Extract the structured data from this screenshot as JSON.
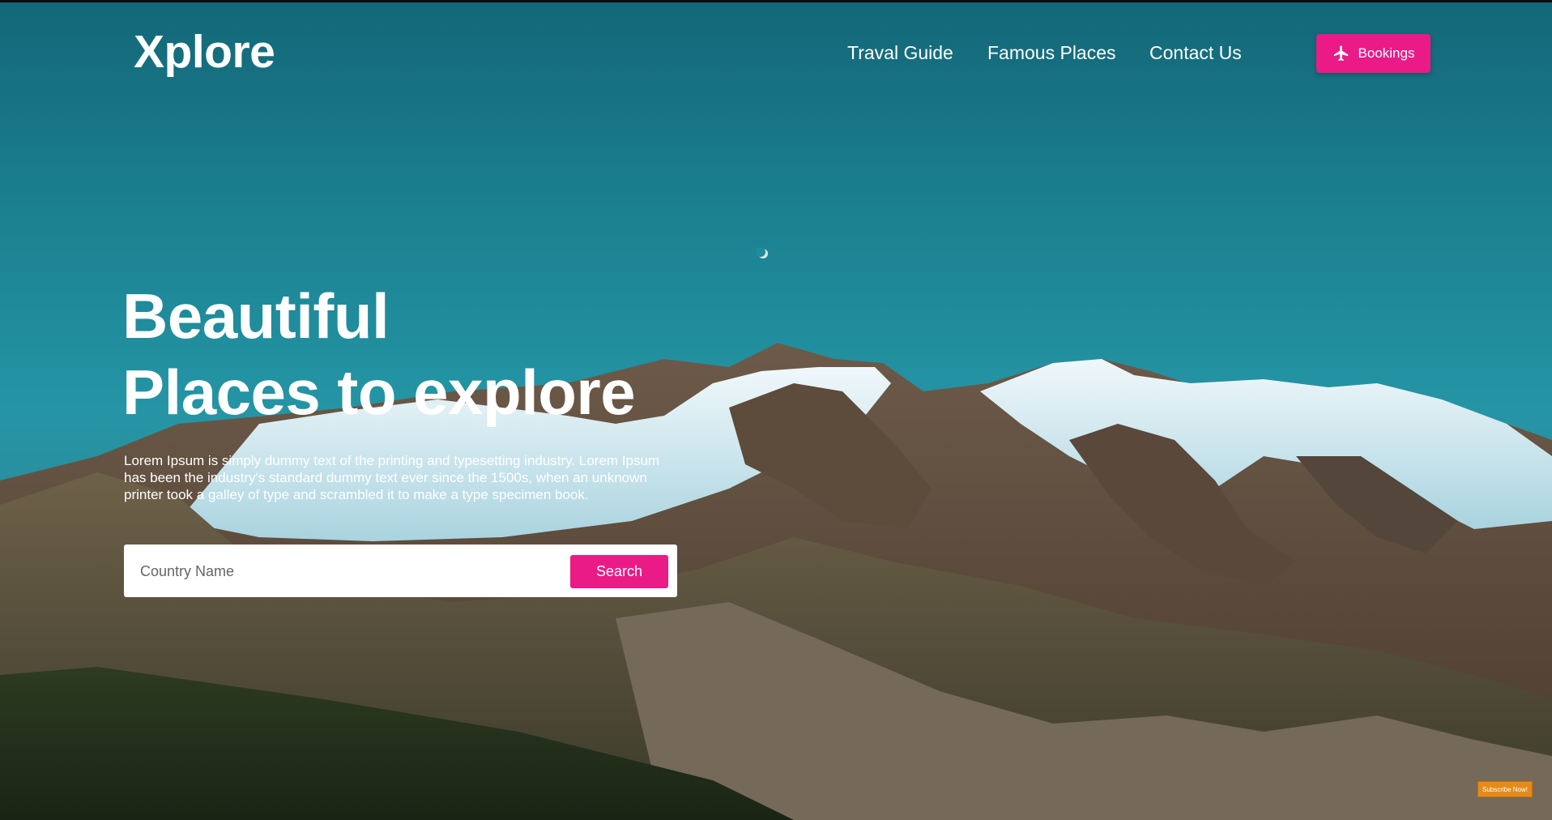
{
  "brand": {
    "logo": "Xplore"
  },
  "nav": {
    "items": [
      {
        "label": "Traval Guide"
      },
      {
        "label": "Famous Places"
      },
      {
        "label": "Contact Us"
      }
    ],
    "bookings_label": "Bookings",
    "bookings_icon": "airplane-icon"
  },
  "hero": {
    "headline_line1": "Beautiful",
    "headline_line2": "Places to explore",
    "description": "Lorem Ipsum is simply dummy text of the printing and typesetting industry. Lorem Ipsum has been the industry's standard dummy text ever since the 1500s, when an unknown printer took a galley of type and scrambled it to make a type specimen book."
  },
  "search": {
    "placeholder": "Country Name",
    "value": "",
    "button_label": "Search"
  },
  "subscribe": {
    "label": "Subscribe Now!"
  },
  "colors": {
    "accent": "#ea1b86",
    "sky": "#1f8b9b",
    "subscribe": "#e48b1a"
  }
}
